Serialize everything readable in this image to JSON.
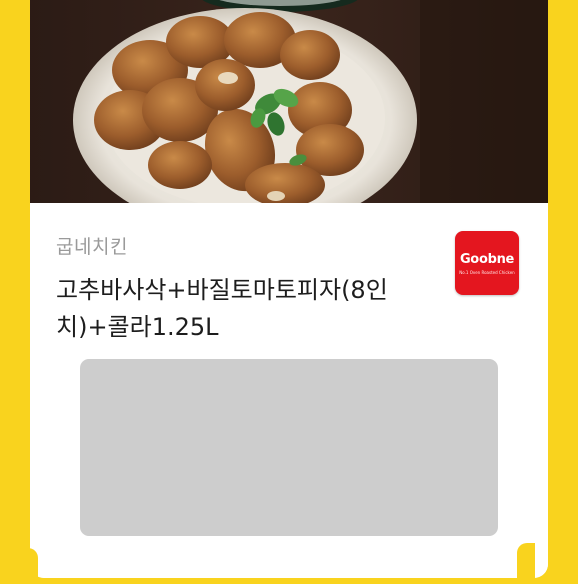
{
  "photo": {
    "subject": "fried-chicken-plate-image"
  },
  "gift": {
    "brand": "굽네치킨",
    "title": "고추바사삭+바질토마토피자(8인치)+콜라1.25L"
  },
  "logo": {
    "wordmark": "Goobne",
    "tagline": "No.1 Oven Roasted Chicken"
  },
  "colors": {
    "background": "#f9d31e",
    "card": "#ffffff",
    "logo": "#e4161f",
    "placeholder": "#cdcdcd"
  }
}
